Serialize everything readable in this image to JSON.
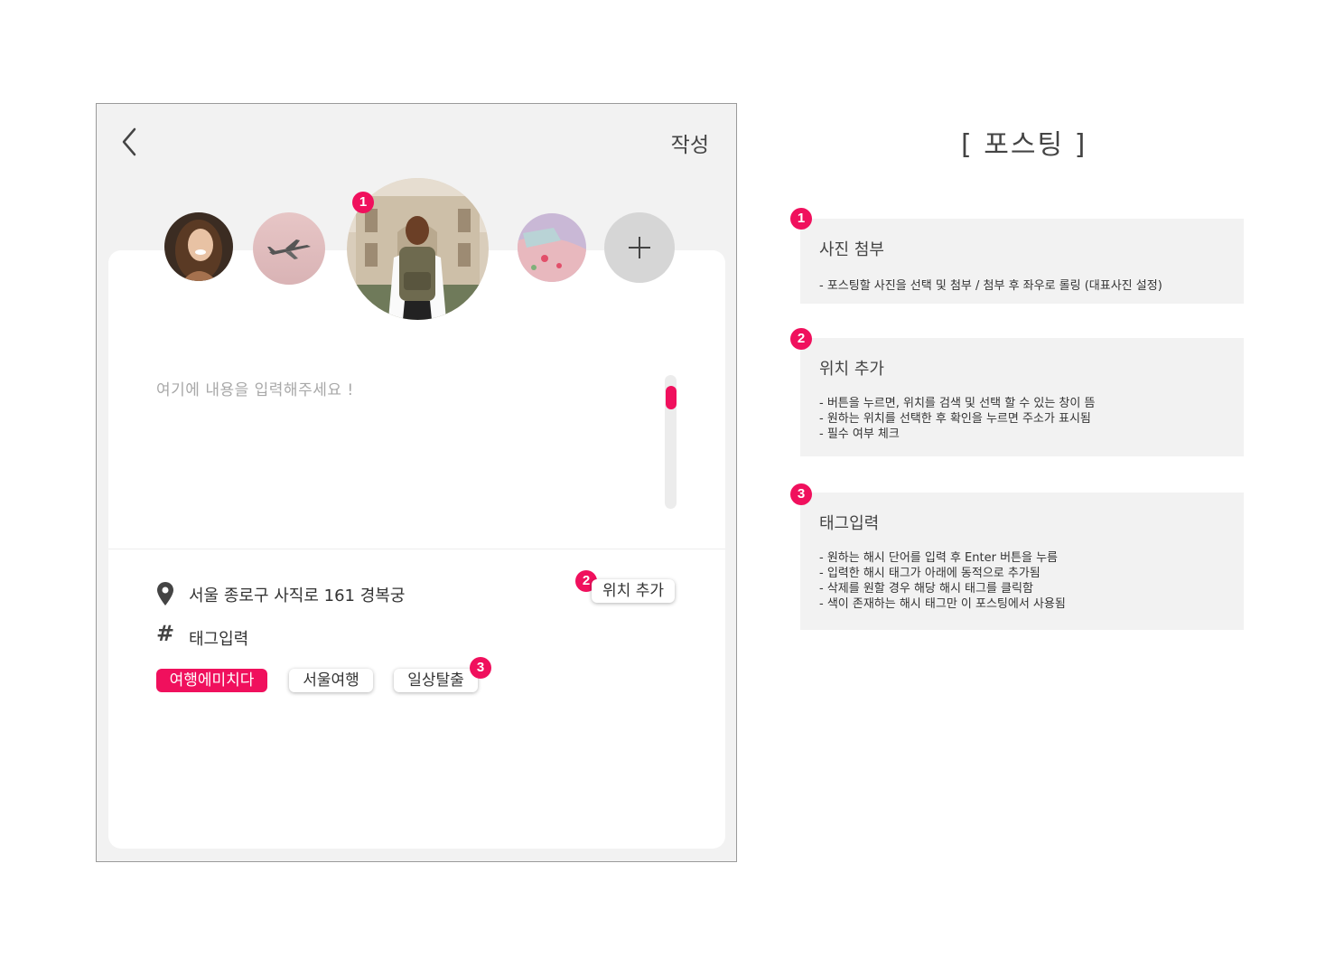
{
  "screen": {
    "write_label": "작성",
    "content_placeholder": "여기에 내용을 입력해주세요 !",
    "location_text": "서울 종로구 사직로 161 경복궁",
    "location_button": "위치 추가",
    "hash_symbol": "#",
    "tag_label": "태그입력",
    "tags": [
      {
        "label": "여행에미치다",
        "active": true
      },
      {
        "label": "서울여행",
        "active": false
      },
      {
        "label": "일상탈출",
        "active": false
      }
    ],
    "badges": [
      "1",
      "2",
      "3"
    ]
  },
  "panel": {
    "title": "[ 포스팅 ]",
    "notes": [
      {
        "number": "1",
        "title": "사진 첨부",
        "lines": [
          "- 포스팅할 사진을 선택 및 첨부 / 첨부 후 좌우로 롤링 (대표사진 설정)"
        ]
      },
      {
        "number": "2",
        "title": "위치 추가",
        "lines": [
          "- 버튼을 누르면, 위치를 검색 및 선택 할 수 있는 창이 뜸",
          "- 원하는 위치를 선택한 후 확인을 누르면 주소가 표시됨",
          "- 필수 여부 체크"
        ]
      },
      {
        "number": "3",
        "title": "태그입력",
        "lines": [
          "- 원하는 해시 단어를 입력 후 Enter 버튼을 누름",
          "- 입력한 해시 태그가 아래에 동적으로 추가됨",
          "- 삭제를 원할 경우 해당 해시 태그를 클릭함",
          "- 색이 존재하는 해시 태그만 이 포스팅에서 사용됨"
        ]
      }
    ]
  },
  "colors": {
    "accent": "#f0105d",
    "panel_bg": "#f2f2f2",
    "placeholder": "#a8a8a8"
  },
  "icons": [
    "back-chevron-icon",
    "plus-icon",
    "location-pin-icon",
    "hash-icon"
  ]
}
